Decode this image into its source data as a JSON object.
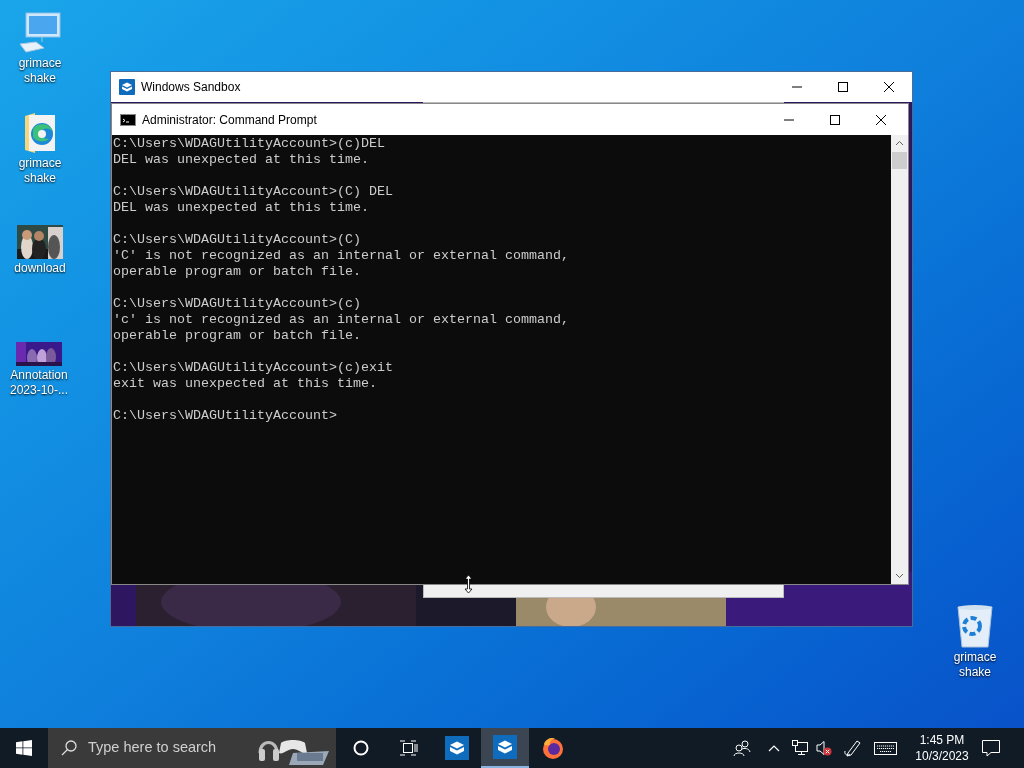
{
  "desktop_icons": [
    {
      "kind": "computer",
      "label": "grimace shake"
    },
    {
      "kind": "edge-folder",
      "label": "grimace shake"
    },
    {
      "label": "download"
    },
    {
      "kind": "photo-wide",
      "label": "Annotation 2023-10-..."
    },
    {
      "kind": "recycle-bin",
      "label": "grimace shake"
    }
  ],
  "sandbox_window": {
    "title": "Windows Sandbox"
  },
  "command_window": {
    "title": "Administrator: Command Prompt",
    "console": [
      {
        "lines": [
          "C:\\Users\\WDAGUtilityAccount>(c)DEL",
          "DEL was unexpected at this time."
        ]
      },
      {
        "lines": [
          "C:\\Users\\WDAGUtilityAccount>(C) DEL",
          "DEL was unexpected at this time."
        ]
      },
      {
        "lines": [
          "C:\\Users\\WDAGUtilityAccount>(C)",
          "'C' is not recognized as an internal or external command,",
          "operable program or batch file."
        ]
      },
      {
        "lines": [
          "C:\\Users\\WDAGUtilityAccount>(c)",
          "'c' is not recognized as an internal or external command,",
          "operable program or batch file."
        ]
      },
      {
        "lines": [
          "C:\\Users\\WDAGUtilityAccount>(c)exit",
          "exit was unexpected at this time."
        ]
      },
      {
        "lines": [
          "C:\\Users\\WDAGUtilityAccount>"
        ]
      }
    ]
  },
  "taskbar": {
    "search": {
      "placeholder": "Type here to search"
    },
    "apps": [
      {
        "kind": "cortana",
        "selected": false
      },
      {
        "kind": "task-view",
        "selected": false
      },
      {
        "kind": "sandbox",
        "selected": false
      },
      {
        "kind": "sandbox",
        "selected": true
      },
      {
        "kind": "firefox",
        "selected": false
      }
    ],
    "time": "1:45 PM",
    "date": "10/3/2023"
  }
}
